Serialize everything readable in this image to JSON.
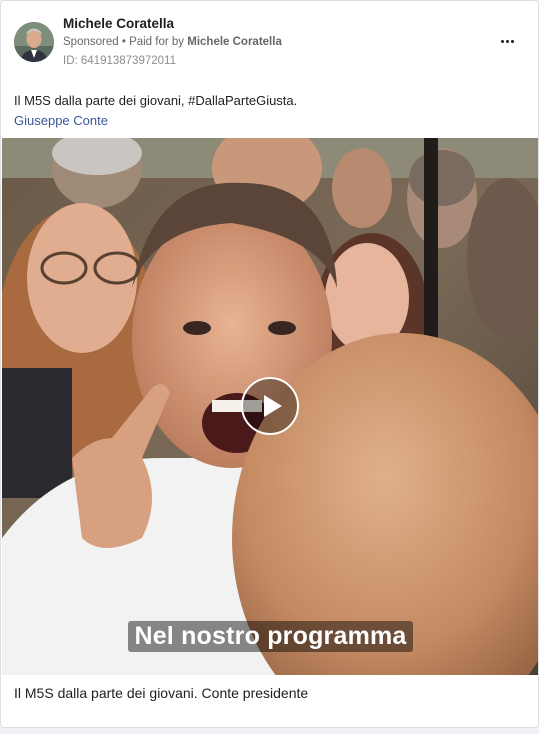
{
  "post": {
    "page_name": "Michele Coratella",
    "sponsored_label": "Sponsored",
    "separator": "•",
    "paid_for_prefix": "Paid for by",
    "paid_for_name": "Michele Coratella",
    "ad_id": "ID: 641913873972011",
    "more_icon": "more-options-icon"
  },
  "content": {
    "body_text": "Il M5S dalla parte dei giovani, #DallaParteGiusta.",
    "mention": "Giuseppe Conte"
  },
  "video": {
    "caption": "Nel nostro programma",
    "play_icon": "play-icon"
  },
  "footer": {
    "text": "Il M5S dalla parte dei giovani. Conte presidente"
  },
  "colors": {
    "link": "#385898",
    "text": "#1c1e21",
    "secondary": "#65676b"
  }
}
